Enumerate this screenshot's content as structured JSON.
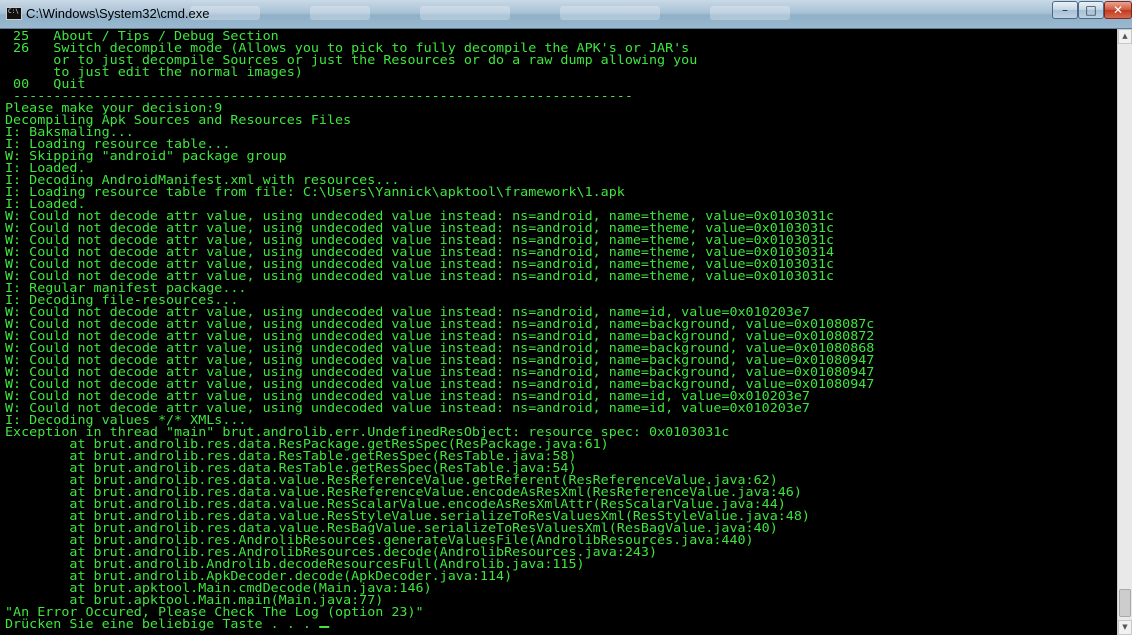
{
  "window": {
    "title": "C:\\Windows\\System32\\cmd.exe",
    "icon_text": "C:\\",
    "buttons": {
      "minimize": "–",
      "maximize": "□",
      "close": "✕"
    }
  },
  "scrollbar": {
    "up_arrow": "▲",
    "down_arrow": "▼"
  },
  "colors": {
    "console_text": "#3ee63e",
    "console_bg": "#000000"
  },
  "console": {
    "lines": [
      " 25   About / Tips / Debug Section",
      " 26   Switch decompile mode (Allows you to pick to fully decompile the APK's or JAR's",
      "      or to just decompile Sources or just the Resources or do a raw dump allowing you",
      "      to just edit the normal images)",
      " 00   Quit",
      " -----------------------------------------------------------------------------",
      "Please make your decision:9",
      "Decompiling Apk Sources and Resources Files",
      "I: Baksmaling...",
      "I: Loading resource table...",
      "W: Skipping \"android\" package group",
      "I: Loaded.",
      "I: Decoding AndroidManifest.xml with resources...",
      "I: Loading resource table from file: C:\\Users\\Yannick\\apktool\\framework\\1.apk",
      "I: Loaded.",
      "W: Could not decode attr value, using undecoded value instead: ns=android, name=theme, value=0x0103031c",
      "W: Could not decode attr value, using undecoded value instead: ns=android, name=theme, value=0x0103031c",
      "W: Could not decode attr value, using undecoded value instead: ns=android, name=theme, value=0x0103031c",
      "W: Could not decode attr value, using undecoded value instead: ns=android, name=theme, value=0x01030314",
      "W: Could not decode attr value, using undecoded value instead: ns=android, name=theme, value=0x0103031c",
      "W: Could not decode attr value, using undecoded value instead: ns=android, name=theme, value=0x0103031c",
      "I: Regular manifest package...",
      "I: Decoding file-resources...",
      "W: Could not decode attr value, using undecoded value instead: ns=android, name=id, value=0x010203e7",
      "W: Could not decode attr value, using undecoded value instead: ns=android, name=background, value=0x0108087c",
      "W: Could not decode attr value, using undecoded value instead: ns=android, name=background, value=0x01080872",
      "W: Could not decode attr value, using undecoded value instead: ns=android, name=background, value=0x01080868",
      "W: Could not decode attr value, using undecoded value instead: ns=android, name=background, value=0x01080947",
      "W: Could not decode attr value, using undecoded value instead: ns=android, name=background, value=0x01080947",
      "W: Could not decode attr value, using undecoded value instead: ns=android, name=background, value=0x01080947",
      "W: Could not decode attr value, using undecoded value instead: ns=android, name=id, value=0x010203e7",
      "W: Could not decode attr value, using undecoded value instead: ns=android, name=id, value=0x010203e7",
      "I: Decoding values */* XMLs...",
      "Exception in thread \"main\" brut.androlib.err.UndefinedResObject: resource spec: 0x0103031c",
      "        at brut.androlib.res.data.ResPackage.getResSpec(ResPackage.java:61)",
      "        at brut.androlib.res.data.ResTable.getResSpec(ResTable.java:58)",
      "        at brut.androlib.res.data.ResTable.getResSpec(ResTable.java:54)",
      "        at brut.androlib.res.data.value.ResReferenceValue.getReferent(ResReferenceValue.java:62)",
      "        at brut.androlib.res.data.value.ResReferenceValue.encodeAsResXml(ResReferenceValue.java:46)",
      "        at brut.androlib.res.data.value.ResScalarValue.encodeAsResXmlAttr(ResScalarValue.java:44)",
      "        at brut.androlib.res.data.value.ResStyleValue.serializeToResValuesXml(ResStyleValue.java:48)",
      "        at brut.androlib.res.data.value.ResBagValue.serializeToResValuesXml(ResBagValue.java:40)",
      "        at brut.androlib.res.AndrolibResources.generateValuesFile(AndrolibResources.java:440)",
      "        at brut.androlib.res.AndrolibResources.decode(AndrolibResources.java:243)",
      "        at brut.androlib.Androlib.decodeResourcesFull(Androlib.java:115)",
      "        at brut.androlib.ApkDecoder.decode(ApkDecoder.java:114)",
      "        at brut.apktool.Main.cmdDecode(Main.java:146)",
      "        at brut.apktool.Main.main(Main.java:77)",
      "\"An Error Occured, Please Check The Log (option 23)\"",
      "Drücken Sie eine beliebige Taste . . . "
    ]
  }
}
